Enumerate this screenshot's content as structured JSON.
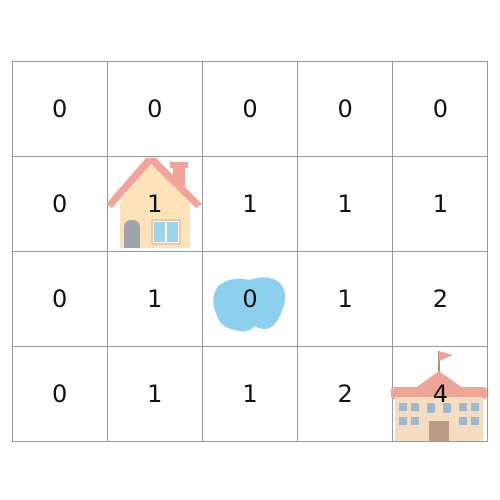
{
  "grid": {
    "rows": [
      [
        "0",
        "0",
        "0",
        "0",
        "0"
      ],
      [
        "0",
        "1",
        "1",
        "1",
        "1"
      ],
      [
        "0",
        "1",
        "0",
        "1",
        "2"
      ],
      [
        "0",
        "1",
        "1",
        "2",
        "4"
      ]
    ]
  },
  "icons": {
    "house": "house-icon",
    "pond": "pond-icon",
    "school": "school-icon"
  },
  "colors": {
    "grid_line": "#9a9a9a",
    "house_roof": "#f2a49a",
    "house_wall": "#fbe2b8",
    "pond": "#8ccfee",
    "school_roof": "#eda597",
    "school_wall": "#f3dcc0"
  }
}
